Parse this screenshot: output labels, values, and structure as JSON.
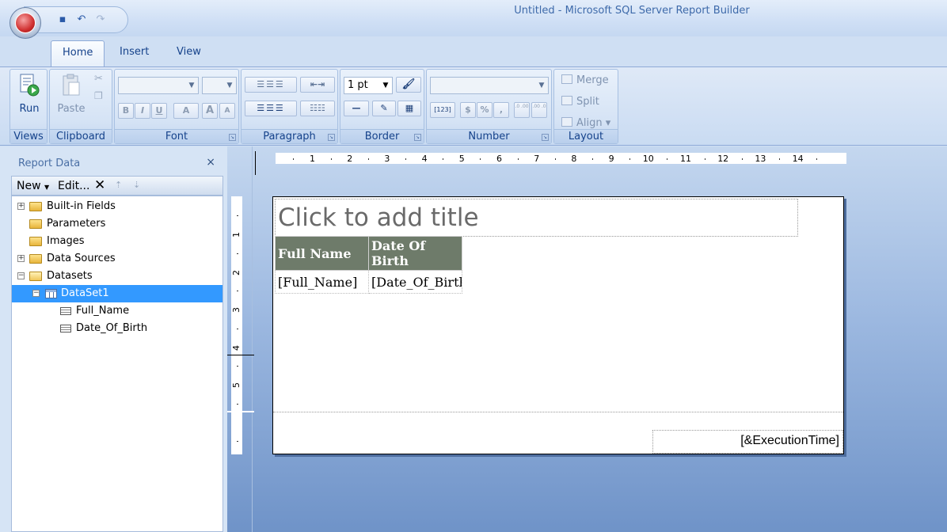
{
  "window": {
    "title": "Untitled - Microsoft SQL Server Report Builder"
  },
  "quick_access": {
    "save_icon": "save-icon",
    "undo_icon": "undo-icon",
    "redo_icon": "redo-icon"
  },
  "tabs": [
    {
      "label": "Home"
    },
    {
      "label": "Insert"
    },
    {
      "label": "View"
    }
  ],
  "ribbon": {
    "views": {
      "run_label": "Run",
      "group_label": "Views"
    },
    "clipboard": {
      "paste_label": "Paste",
      "group_label": "Clipboard"
    },
    "font": {
      "group_label": "Font",
      "bold": "B",
      "italic": "I",
      "underline": "U",
      "font_color": "A",
      "grow": "A",
      "shrink": "A"
    },
    "paragraph": {
      "group_label": "Paragraph"
    },
    "border": {
      "group_label": "Border",
      "width_value": "1 pt"
    },
    "number": {
      "group_label": "Number",
      "placeholders": "[123]",
      "currency": "$",
      "percent": "%",
      "comma": ",",
      "inc_decimal": ".0 .00",
      "dec_decimal": ".00 .0"
    },
    "layout": {
      "group_label": "Layout",
      "merge_label": "Merge",
      "split_label": "Split",
      "align_label": "Align"
    }
  },
  "report_data": {
    "title": "Report Data",
    "close": "×",
    "toolbar": {
      "new_label": "New",
      "edit_label": "Edit...",
      "delete": "✕",
      "up": "⇡",
      "down": "⇣"
    },
    "tree": [
      {
        "label": "Built-in Fields"
      },
      {
        "label": "Parameters"
      },
      {
        "label": "Images"
      },
      {
        "label": "Data Sources"
      },
      {
        "label": "Datasets"
      },
      {
        "label": "DataSet1"
      },
      {
        "label": "Full_Name"
      },
      {
        "label": "Date_Of_Birth"
      }
    ]
  },
  "ruler": {
    "h_numbers": [
      "1",
      "2",
      "3",
      "4",
      "5",
      "6",
      "7",
      "8",
      "9",
      "10",
      "11",
      "12",
      "13",
      "14"
    ],
    "v_numbers": [
      "1",
      "2",
      "3",
      "4",
      "5"
    ]
  },
  "report": {
    "title_placeholder": "Click to add title",
    "columns": [
      "Full Name",
      "Date Of Birth"
    ],
    "row": [
      "[Full_Name]",
      "[Date_Of_Birth]"
    ],
    "footer_expression": "[&ExecutionTime]"
  },
  "colors": {
    "header_fill": "#6e7b6a",
    "selection": "#3399ff"
  }
}
